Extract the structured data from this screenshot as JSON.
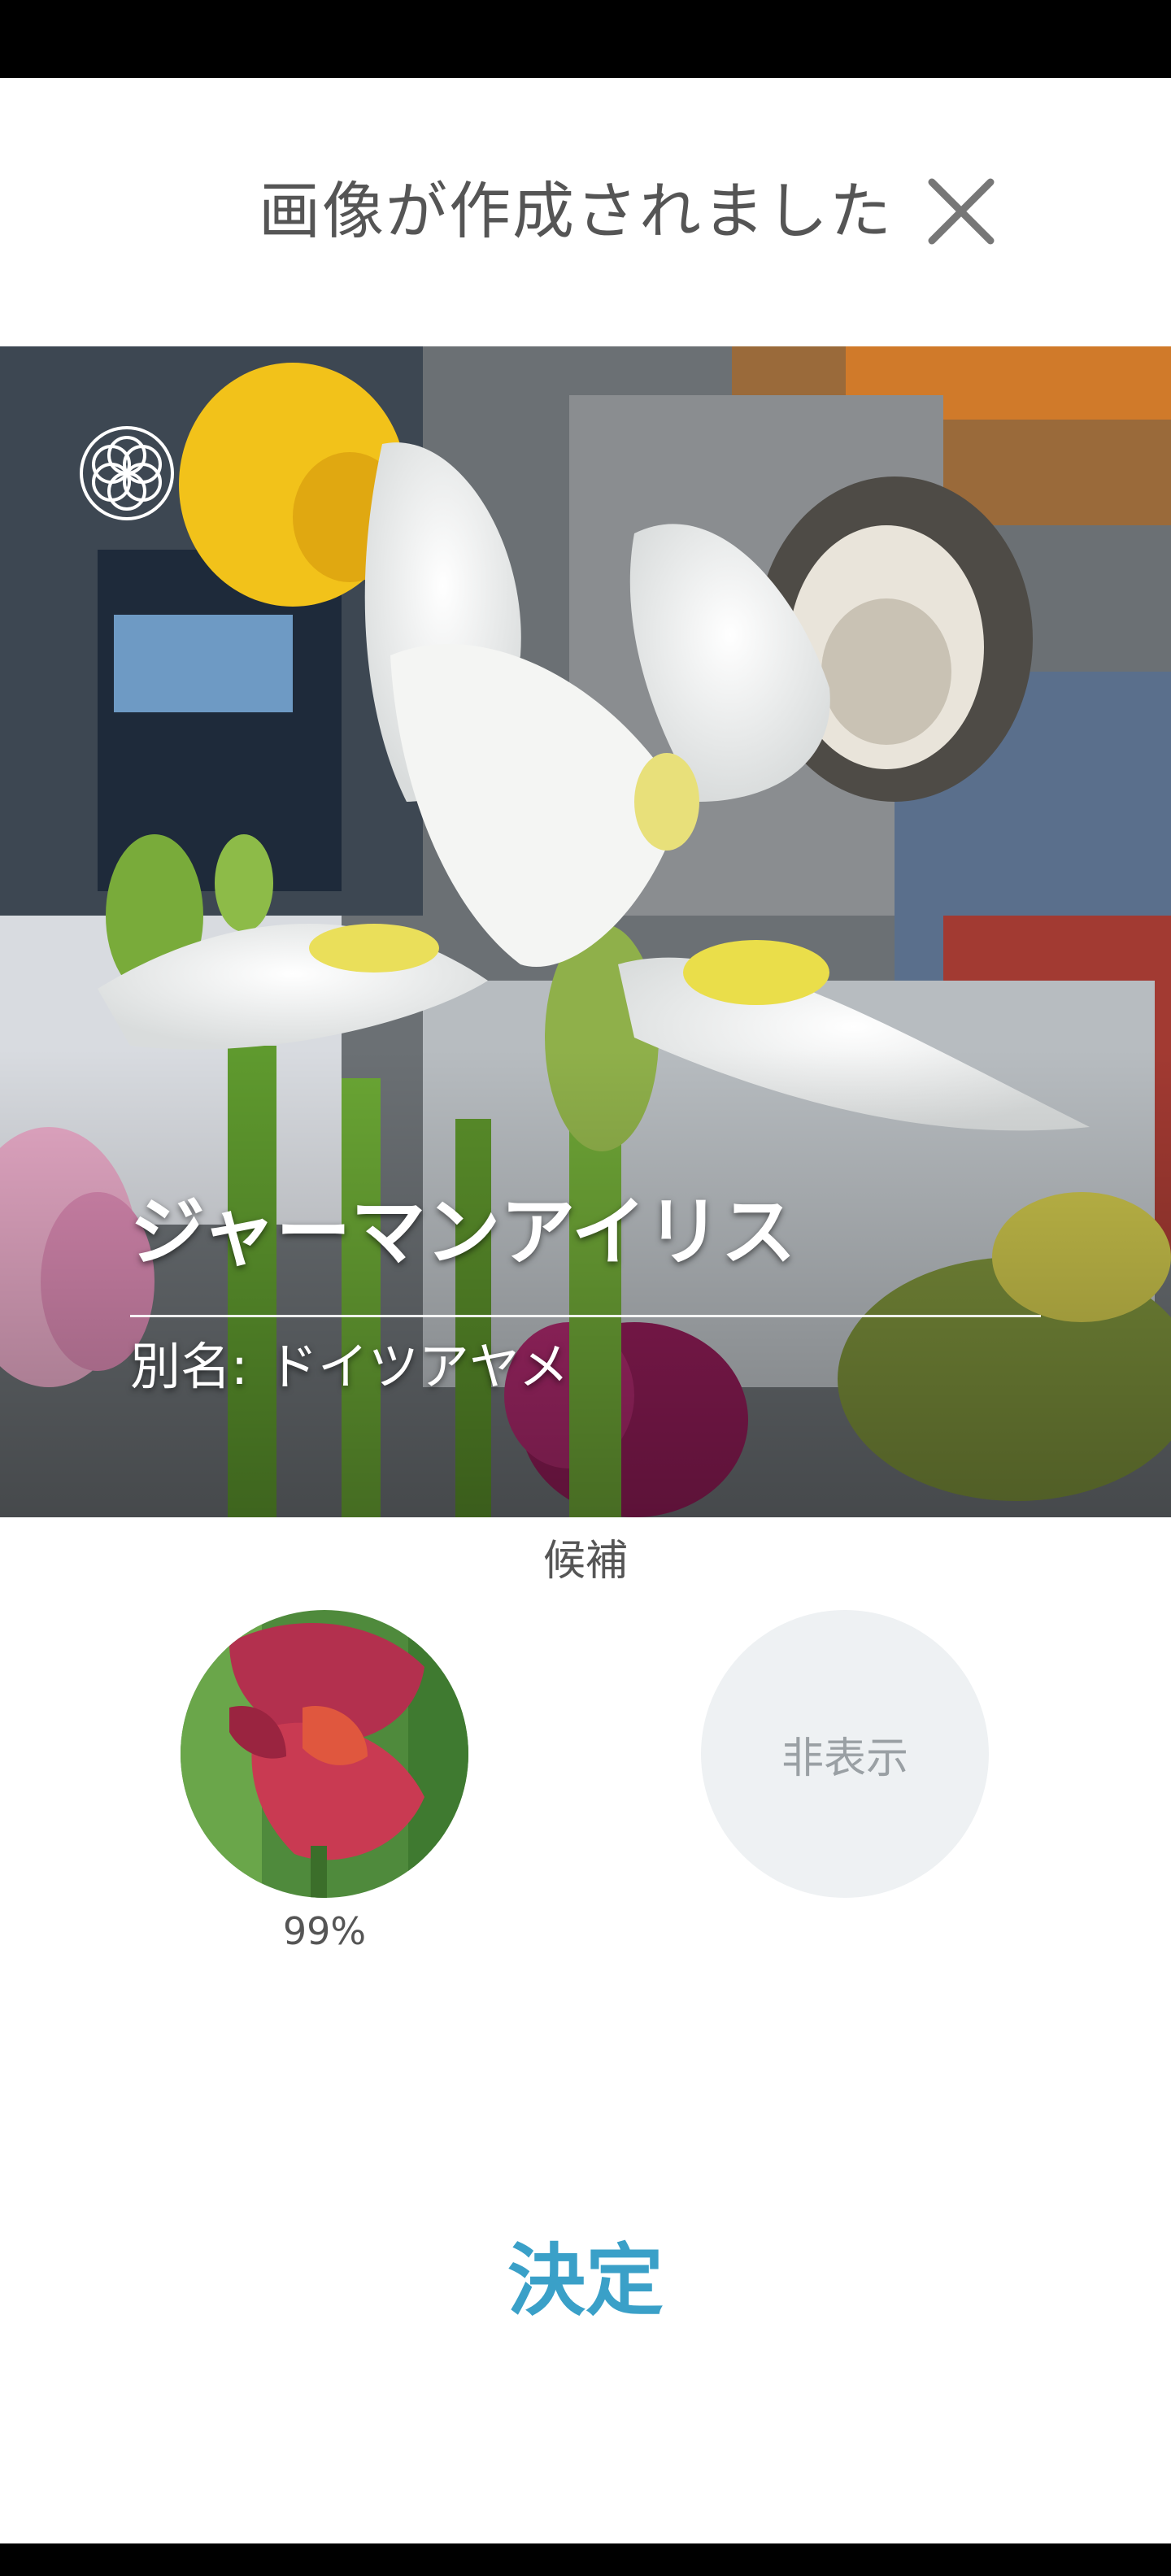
{
  "header": {
    "title": "画像が作成されました",
    "close_icon": "close-icon"
  },
  "result": {
    "flower_name": "ジャーマンアイリス",
    "alias_label": "別名:",
    "alias_value": "ドイツアヤメ",
    "logo_icon": "flower-of-life-logo-icon"
  },
  "candidates": {
    "label": "候補",
    "items": [
      {
        "percent": "99%",
        "image": "red-iris-thumbnail"
      }
    ],
    "hide_label": "非表示"
  },
  "actions": {
    "confirm_label": "決定"
  },
  "colors": {
    "accent": "#3aa0c8",
    "title_text": "#555555",
    "hide_bg": "#eef1f3"
  }
}
